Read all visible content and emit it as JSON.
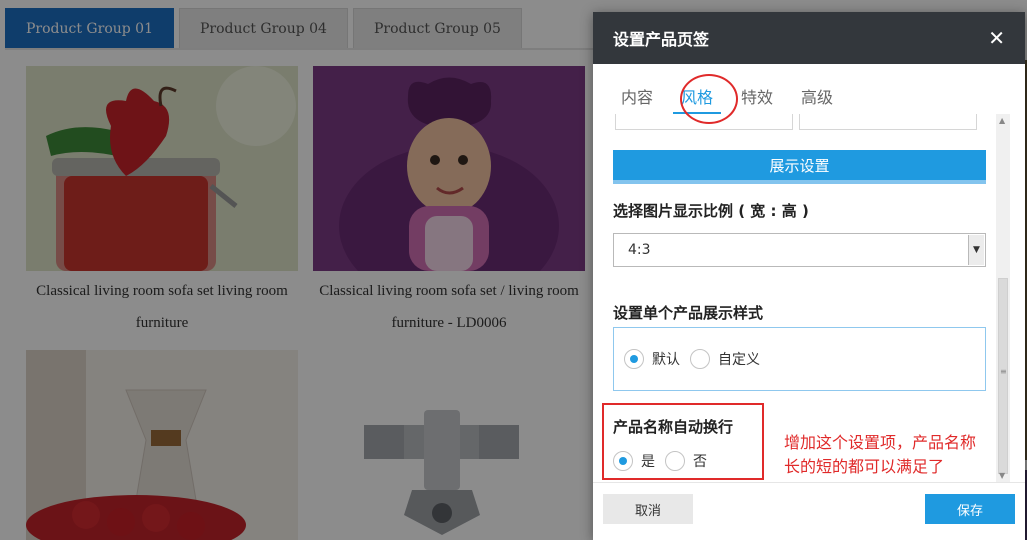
{
  "background": {
    "tabs": [
      {
        "label": "Product Group 01",
        "active": true
      },
      {
        "label": "Product Group 04",
        "active": false
      },
      {
        "label": "Product Group 05",
        "active": false
      }
    ],
    "products": [
      {
        "caption": "Classical living room sofa set living room furniture",
        "image": "strawberry-jar-image"
      },
      {
        "caption": "Classical living room sofa set / living room furniture - LD0006",
        "image": "child-costume-image"
      },
      {
        "caption": "",
        "image": "strawberries-coffee-image"
      },
      {
        "caption": "",
        "image": "pipe-fitting-image"
      }
    ]
  },
  "dialog": {
    "title": "设置产品页签",
    "tabs": [
      "内容",
      "风格",
      "特效",
      "高级"
    ],
    "active_tab": "风格",
    "section_title": "展示设置",
    "ratio_label": "选择图片显示比例 ( 宽 : 高 )",
    "ratio_value": "4:3",
    "style_label": "设置单个产品展示样式",
    "style_options": [
      "默认",
      "自定义"
    ],
    "style_selected": "默认",
    "wrap_label": "产品名称自动换行",
    "wrap_options": [
      "是",
      "否"
    ],
    "wrap_selected": "是",
    "cancel_label": "取消",
    "save_label": "保存"
  },
  "annotation": {
    "line1": "增加这个设置项，产品名称",
    "line2": "长的短的都可以满足了"
  },
  "colors": {
    "accent": "#1f9ae0",
    "tab_active": "#1c6fc4",
    "header": "#33373c",
    "highlight_red": "#e02a2a"
  }
}
